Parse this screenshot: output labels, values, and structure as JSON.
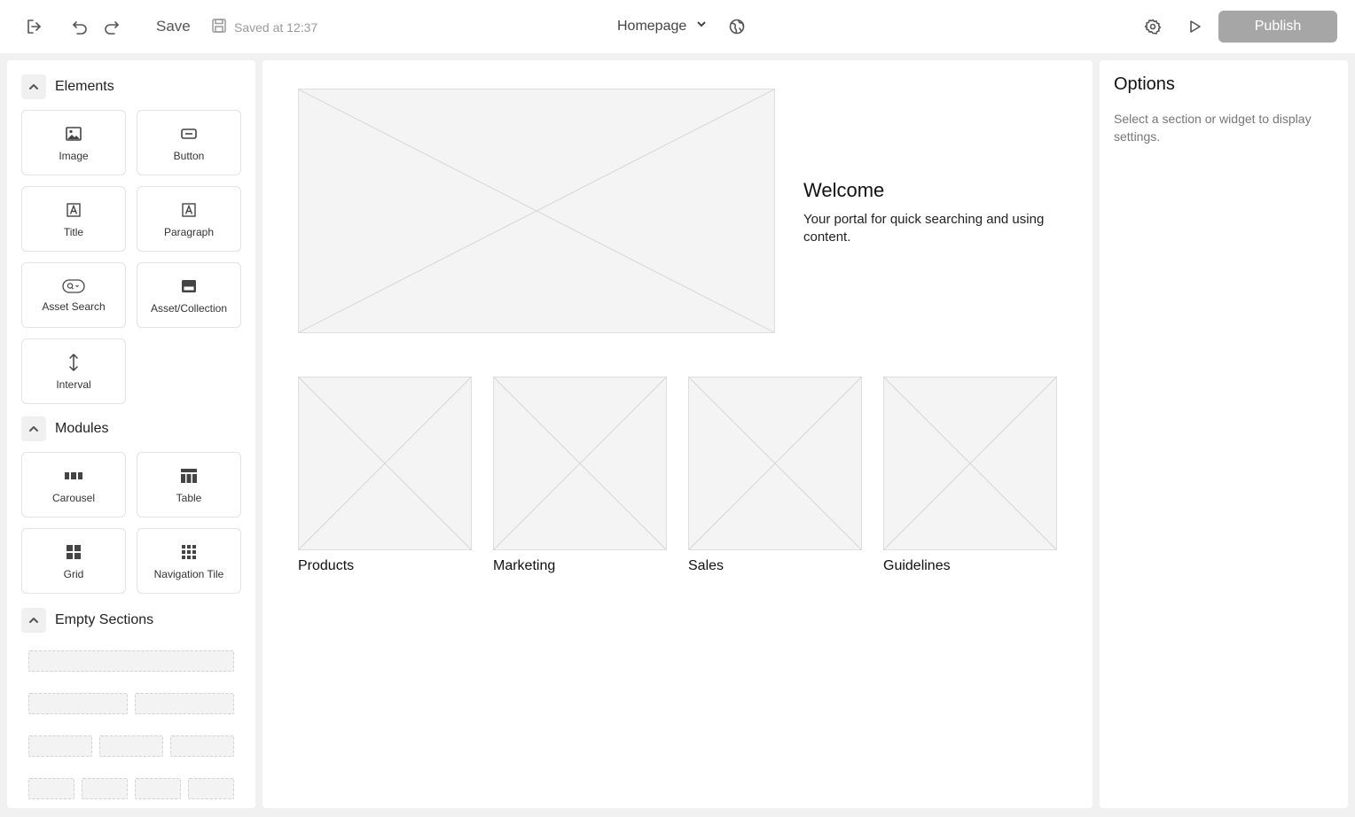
{
  "toolbar": {
    "save_label": "Save",
    "saved_status": "Saved at 12:37",
    "page_name": "Homepage",
    "publish_label": "Publish"
  },
  "left_panel": {
    "elements": {
      "title": "Elements",
      "items": [
        {
          "label": "Image",
          "icon": "image-icon"
        },
        {
          "label": "Button",
          "icon": "button-icon"
        },
        {
          "label": "Title",
          "icon": "title-icon"
        },
        {
          "label": "Paragraph",
          "icon": "paragraph-icon"
        },
        {
          "label": "Asset Search",
          "icon": "asset-search-icon"
        },
        {
          "label": "Asset/Collection",
          "icon": "asset-collection-icon"
        },
        {
          "label": "Interval",
          "icon": "interval-icon"
        }
      ]
    },
    "modules": {
      "title": "Modules",
      "items": [
        {
          "label": "Carousel",
          "icon": "carousel-icon"
        },
        {
          "label": "Table",
          "icon": "table-icon"
        },
        {
          "label": "Grid",
          "icon": "grid-icon"
        },
        {
          "label": "Navigation Tile",
          "icon": "navigation-tile-icon"
        }
      ]
    },
    "empty_sections": {
      "title": "Empty Sections"
    }
  },
  "canvas": {
    "hero": {
      "title": "Welcome",
      "subtitle": "Your portal for quick searching and using content."
    },
    "cards": [
      {
        "label": "Products"
      },
      {
        "label": "Marketing"
      },
      {
        "label": "Sales"
      },
      {
        "label": "Guidelines"
      }
    ]
  },
  "options_panel": {
    "title": "Options",
    "hint": "Select a section or widget to display settings."
  }
}
